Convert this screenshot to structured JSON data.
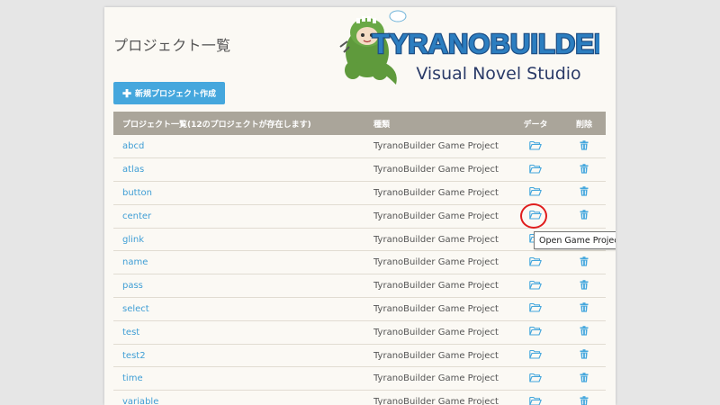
{
  "page": {
    "title": "プロジェクト一覧",
    "new_button_label": "新規プロジェクト作成"
  },
  "logo": {
    "title": "TYRANOBUILDER",
    "subtitle": "Visual Novel Studio"
  },
  "table": {
    "headers": [
      "プロジェクト一覧(12のプロジェクトが存在します)",
      "種類",
      "データ",
      "削除"
    ],
    "rows": [
      {
        "name": "abcd",
        "type": "TyranoBuilder Game Project"
      },
      {
        "name": "atlas",
        "type": "TyranoBuilder Game Project"
      },
      {
        "name": "button",
        "type": "TyranoBuilder Game Project"
      },
      {
        "name": "center",
        "type": "TyranoBuilder Game Project"
      },
      {
        "name": "glink",
        "type": "TyranoBuilder Game Project"
      },
      {
        "name": "name",
        "type": "TyranoBuilder Game Project"
      },
      {
        "name": "pass",
        "type": "TyranoBuilder Game Project"
      },
      {
        "name": "select",
        "type": "TyranoBuilder Game Project"
      },
      {
        "name": "test",
        "type": "TyranoBuilder Game Project"
      },
      {
        "name": "test2",
        "type": "TyranoBuilder Game Project"
      },
      {
        "name": "time",
        "type": "TyranoBuilder Game Project"
      },
      {
        "name": "variable",
        "type": "TyranoBuilder Game Project"
      }
    ]
  },
  "tooltip": {
    "text": "Open Game Project Folder"
  },
  "icons": {
    "folder": "folder-open-icon",
    "trash": "trash-icon",
    "plus": "plus-icon"
  },
  "colors": {
    "accent": "#45a7dd",
    "header_bg": "#aaa59a",
    "highlight": "#e01d1d"
  }
}
